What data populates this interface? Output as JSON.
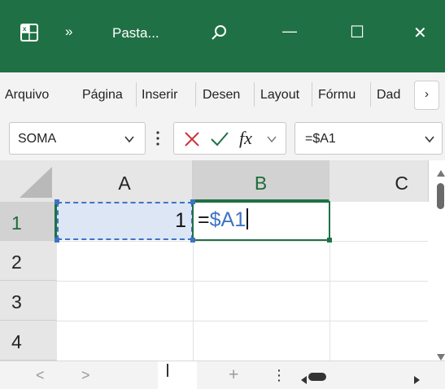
{
  "titlebar": {
    "app_icon": "excel-icon",
    "overflow_label": "»",
    "title": "Pasta...",
    "search_icon": "search-icon",
    "minimize_label": "—",
    "maximize_label": "☐",
    "close_label": "✕",
    "bg_color": "#1f7145"
  },
  "ribbon": {
    "tabs": [
      "Arquivo",
      "Página",
      "Inserir",
      "Desen",
      "Layout",
      "Fórmu",
      "Dad"
    ],
    "more_label": "›"
  },
  "formula_bar": {
    "name_box": "SOMA",
    "cancel_icon": "cancel-x-icon",
    "enter_icon": "check-icon",
    "fx_label": "fx",
    "formula": "=$A1"
  },
  "grid": {
    "columns": [
      "A",
      "B",
      "C"
    ],
    "rows": [
      "1",
      "2",
      "3",
      "4"
    ],
    "cells": {
      "A1": "1",
      "B1_eq": "=",
      "B1_ref": "$A1"
    },
    "accent_color": "#1f7145",
    "reference_color": "#3d74c5"
  },
  "statusbar": {
    "prev": "<",
    "next": ">",
    "add_sheet": "+",
    "more": "⋮"
  }
}
